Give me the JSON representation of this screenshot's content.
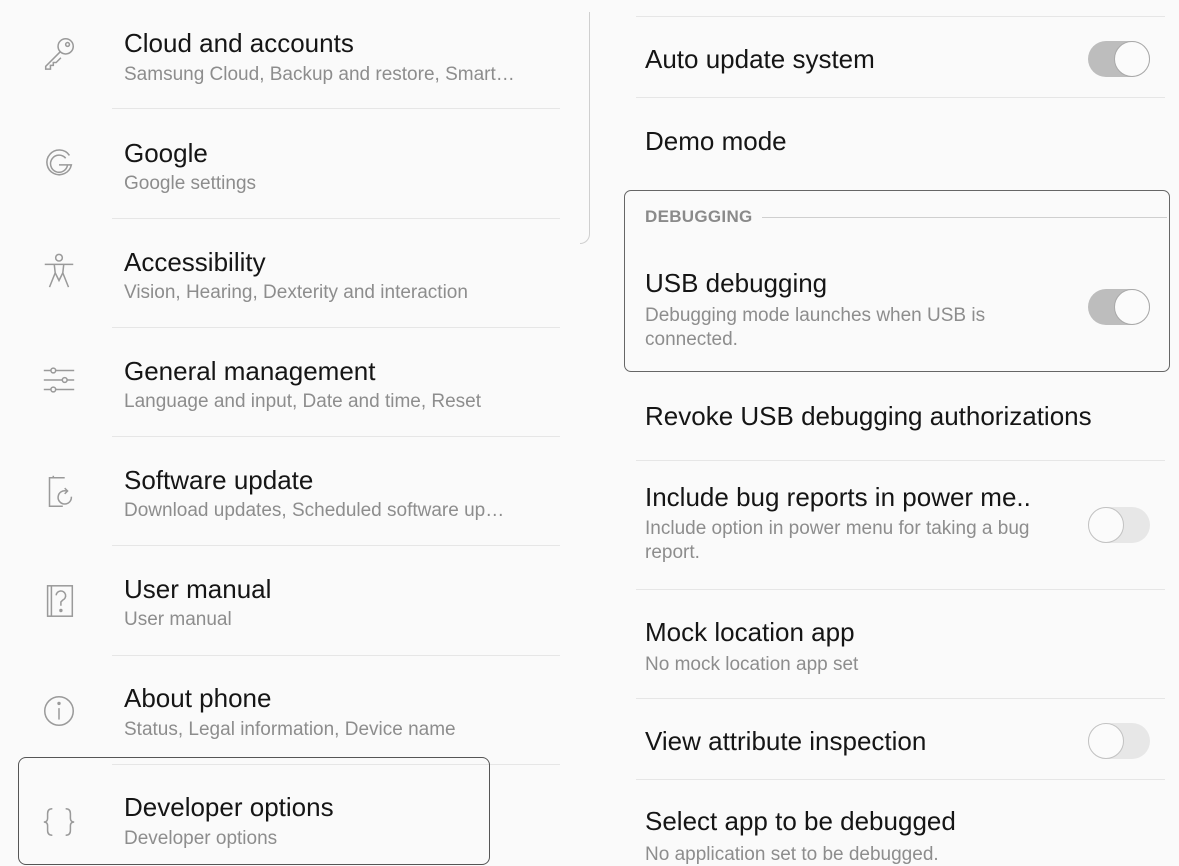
{
  "left_menu": {
    "items": [
      {
        "title": "Cloud and accounts",
        "subtitle": "Samsung Cloud, Backup and restore, Smart…",
        "icon": "key-icon"
      },
      {
        "title": "Google",
        "subtitle": "Google settings",
        "icon": "google-icon"
      },
      {
        "title": "Accessibility",
        "subtitle": "Vision, Hearing, Dexterity and interaction",
        "icon": "accessibility-icon"
      },
      {
        "title": "General management",
        "subtitle": "Language and input, Date and time, Reset",
        "icon": "sliders-icon"
      },
      {
        "title": "Software update",
        "subtitle": "Download updates, Scheduled software up…",
        "icon": "software-update-icon"
      },
      {
        "title": "User manual",
        "subtitle": "User manual",
        "icon": "help-icon"
      },
      {
        "title": "About phone",
        "subtitle": "Status, Legal information, Device name",
        "icon": "info-icon"
      },
      {
        "title": "Developer options",
        "subtitle": "Developer options",
        "icon": "braces-icon"
      }
    ]
  },
  "developer_options": {
    "auto_update_system": {
      "title": "Auto update system",
      "enabled": true
    },
    "demo_mode": {
      "title": "Demo mode"
    },
    "section_debugging": "DEBUGGING",
    "usb_debugging": {
      "title": "USB debugging",
      "subtitle": "Debugging mode launches when USB is connected.",
      "enabled": true
    },
    "revoke_usb": {
      "title": "Revoke USB debugging authorizations"
    },
    "bug_reports": {
      "title": "Include bug reports in power me..",
      "subtitle": "Include option in power menu for taking a bug report.",
      "enabled": false
    },
    "mock_location": {
      "title": "Mock location app",
      "subtitle": "No mock location app set"
    },
    "view_attribute": {
      "title": "View attribute inspection",
      "enabled": false
    },
    "select_debug_app": {
      "title": "Select app to be debugged",
      "subtitle": "No application set to be debugged."
    }
  },
  "colors": {
    "toggle_on": "#bdbdbd",
    "toggle_off": "#e7e7e7",
    "text": "#151515",
    "subtext": "#8d8d8d"
  }
}
